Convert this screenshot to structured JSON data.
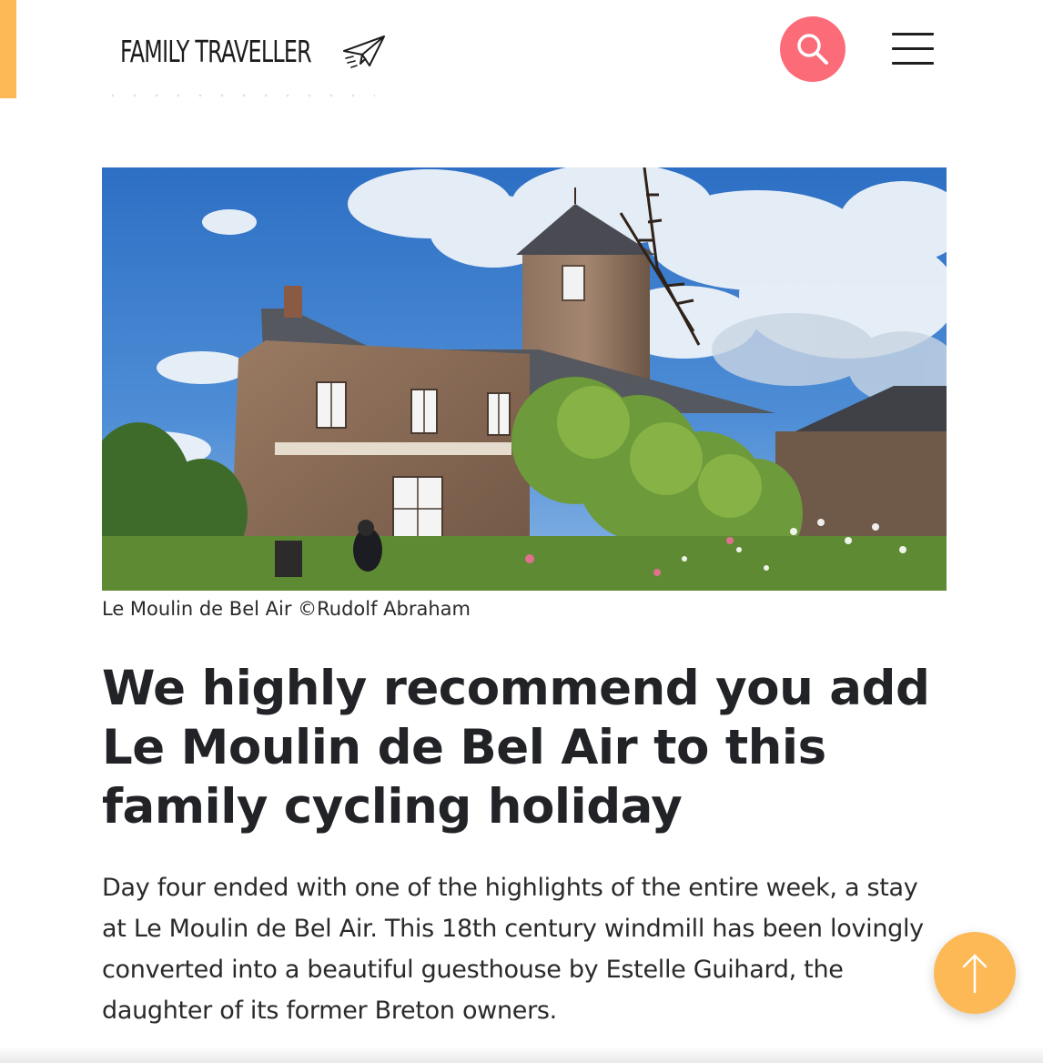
{
  "header": {
    "logo_text": "FAMILY TRAVELLER",
    "logo_icon": "paper-plane-icon",
    "search_icon": "search-icon",
    "menu_icon": "hamburger-menu-icon"
  },
  "article": {
    "image_caption": "Le Moulin de Bel Air ©Rudolf Abraham",
    "heading": "We highly recommend you add Le Moulin de Bel Air to this family cycling holiday",
    "paragraph": "Day four ended with one of the highlights of the entire week, a stay at Le Moulin de Bel Air. This 18th century windmill has been lovingly converted into a beautiful guesthouse by Estelle Guihard, the daughter of its former Breton owners."
  },
  "scroll_top": {
    "icon": "arrow-up-icon"
  },
  "colors": {
    "accent_orange": "#fdb955",
    "search_pink": "#fb6b78",
    "text_dark": "#222327"
  }
}
